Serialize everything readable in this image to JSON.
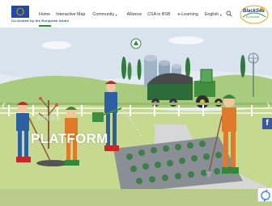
{
  "header": {
    "cofund_text": "Co-funded by the European Union",
    "nav": [
      {
        "label": "Home",
        "dropdown": false
      },
      {
        "label": "Interactive Map",
        "dropdown": false
      },
      {
        "label": "Community",
        "dropdown": true
      },
      {
        "label": "Alliance",
        "dropdown": false
      },
      {
        "label": "CSA in BSB",
        "dropdown": false
      },
      {
        "label": "e-Learning",
        "dropdown": false
      },
      {
        "label": "English",
        "dropdown": true
      }
    ],
    "logo": {
      "line1": "BlackSea",
      "line2": "PLATFORM"
    }
  },
  "hero": {
    "green_text": "GREEN",
    "platform_text": "PLATFORM",
    "facebook_label": "f"
  },
  "colors": {
    "nav_active_underline": "#2e8b3e",
    "platform_text": "#ffffff",
    "facebook": "#3b5998",
    "eu_blue": "#1f4aa8"
  },
  "icons": [
    "eu-flag-icon",
    "search-icon",
    "chevron-down-icon",
    "facebook-icon",
    "recaptcha-icon",
    "arrow-left-icon",
    "arrow-right-icon"
  ]
}
